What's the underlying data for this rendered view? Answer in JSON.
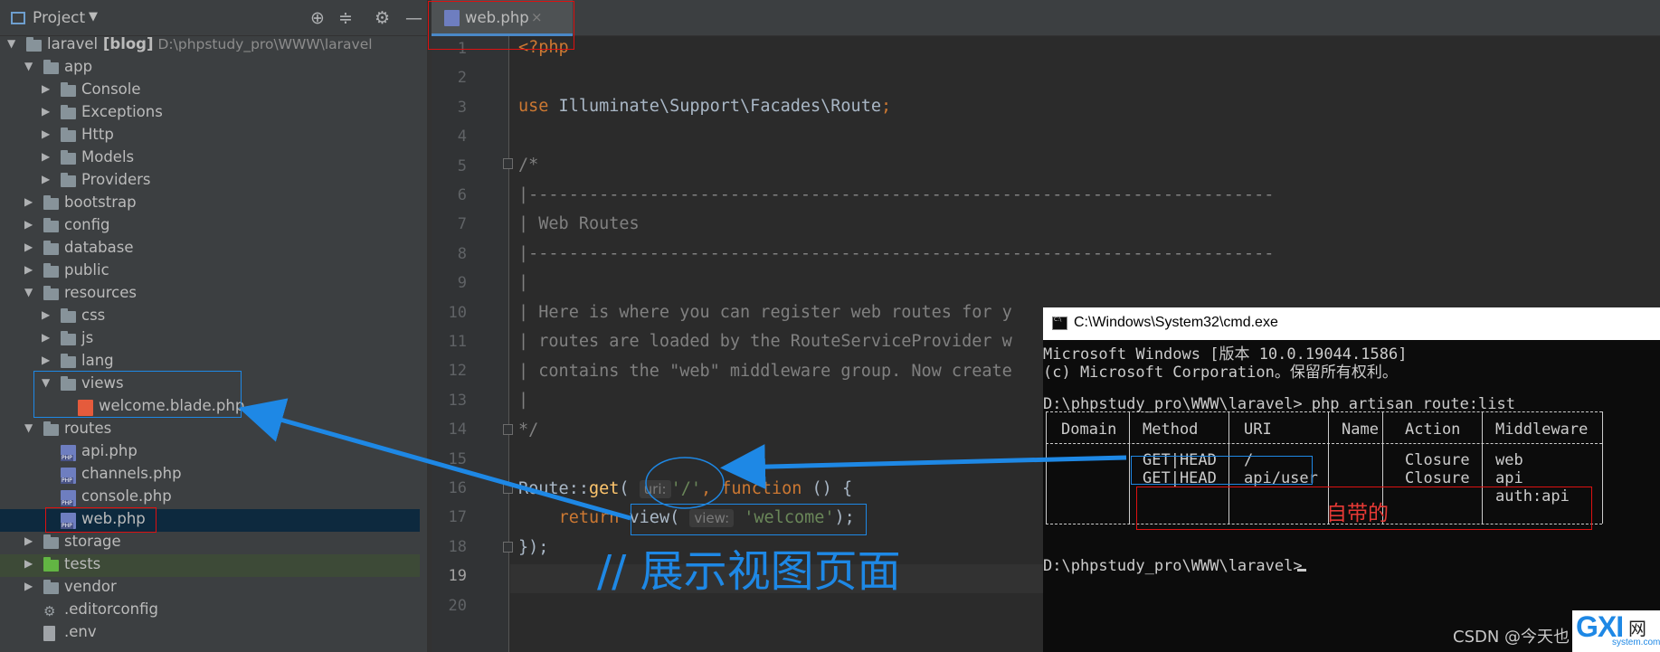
{
  "sidebar": {
    "title": "Project",
    "dropdown_glyph": "▼",
    "icons": [
      "target-icon",
      "collapse-icon",
      "gear-icon",
      "minimize-icon"
    ],
    "tree": [
      {
        "name": "tree-laravel",
        "label": "laravel",
        "extra": " [blog]",
        "path": "D:\\phpstudy_pro\\WWW\\laravel",
        "type": "folder",
        "open": true,
        "depth": 0
      },
      {
        "name": "tree-app",
        "label": "app",
        "type": "folder",
        "open": true,
        "depth": 1
      },
      {
        "name": "tree-console",
        "label": "Console",
        "type": "folder",
        "open": false,
        "depth": 2
      },
      {
        "name": "tree-exceptions",
        "label": "Exceptions",
        "type": "folder",
        "open": false,
        "depth": 2
      },
      {
        "name": "tree-http",
        "label": "Http",
        "type": "folder",
        "open": false,
        "depth": 2
      },
      {
        "name": "tree-models",
        "label": "Models",
        "type": "folder",
        "open": false,
        "depth": 2
      },
      {
        "name": "tree-providers",
        "label": "Providers",
        "type": "folder",
        "open": false,
        "depth": 2
      },
      {
        "name": "tree-bootstrap",
        "label": "bootstrap",
        "type": "folder",
        "open": false,
        "depth": 1
      },
      {
        "name": "tree-config",
        "label": "config",
        "type": "folder",
        "open": false,
        "depth": 1
      },
      {
        "name": "tree-database",
        "label": "database",
        "type": "folder",
        "open": false,
        "depth": 1
      },
      {
        "name": "tree-public",
        "label": "public",
        "type": "folder",
        "open": false,
        "depth": 1
      },
      {
        "name": "tree-resources",
        "label": "resources",
        "type": "folder",
        "open": true,
        "depth": 1
      },
      {
        "name": "tree-css",
        "label": "css",
        "type": "folder",
        "open": false,
        "depth": 2
      },
      {
        "name": "tree-js",
        "label": "js",
        "type": "folder",
        "open": false,
        "depth": 2
      },
      {
        "name": "tree-lang",
        "label": "lang",
        "type": "folder",
        "open": false,
        "depth": 2
      },
      {
        "name": "tree-views",
        "label": "views",
        "type": "folder",
        "open": true,
        "depth": 2
      },
      {
        "name": "tree-welcome-blade",
        "label": "welcome.blade.php",
        "type": "blade",
        "depth": 3
      },
      {
        "name": "tree-routes",
        "label": "routes",
        "type": "folder",
        "open": true,
        "depth": 1
      },
      {
        "name": "tree-api-php",
        "label": "api.php",
        "type": "php",
        "depth": 2
      },
      {
        "name": "tree-channels-php",
        "label": "channels.php",
        "type": "php",
        "depth": 2
      },
      {
        "name": "tree-console-php",
        "label": "console.php",
        "type": "php",
        "depth": 2
      },
      {
        "name": "tree-web-php",
        "label": "web.php",
        "type": "php",
        "depth": 2,
        "selected": true
      },
      {
        "name": "tree-storage",
        "label": "storage",
        "type": "folder",
        "open": false,
        "depth": 1
      },
      {
        "name": "tree-tests",
        "label": "tests",
        "type": "folder-green",
        "open": false,
        "depth": 1
      },
      {
        "name": "tree-vendor",
        "label": "vendor",
        "type": "folder",
        "open": false,
        "depth": 1
      },
      {
        "name": "tree-editorconfig",
        "label": ".editorconfig",
        "type": "gear",
        "depth": 1
      },
      {
        "name": "tree-env",
        "label": ".env",
        "type": "doc",
        "depth": 1
      }
    ]
  },
  "editor": {
    "tab": {
      "label": "web.php",
      "close": "×"
    },
    "line_numbers": [
      "1",
      "2",
      "3",
      "4",
      "5",
      "6",
      "7",
      "8",
      "9",
      "10",
      "11",
      "12",
      "13",
      "14",
      "15",
      "16",
      "17",
      "18",
      "19",
      "20"
    ],
    "lines": {
      "l1": "<?php",
      "l3_kw": "use",
      "l3_rest": " Illuminate\\Support\\Facades\\Route",
      "l3_semi": ";",
      "l5": "/*",
      "l6": "|--------------------------------------------------------------------------",
      "l7": "| Web Routes",
      "l8": "|--------------------------------------------------------------------------",
      "l9": "|",
      "l10": "| Here is where you can register web routes for y",
      "l11": "| routes are loaded by the RouteServiceProvider w",
      "l12": "| contains the \"web\" middleware group. Now create",
      "l13": "|",
      "l14": "*/",
      "l16_a": "Route::",
      "l16_fn": "get",
      "l16_b": "( ",
      "l16_hint": "uri:",
      "l16_str": "'/'",
      "l16_c": ", ",
      "l16_kw": "function",
      "l16_d": " () {",
      "l17_kw": "return",
      "l17_a": " view( ",
      "l17_hint": "view:",
      "l17_str": "'welcome'",
      "l17_b": ");",
      "l18": "});"
    }
  },
  "cmd": {
    "title": "C:\\Windows\\System32\\cmd.exe",
    "line1": "Microsoft Windows [版本 10.0.19044.1586]",
    "line2": "(c) Microsoft Corporation。保留所有权利。",
    "prompt1": "D:\\phpstudy_pro\\WWW\\laravel> php artisan route:list",
    "headers": [
      "Domain",
      "Method",
      "URI",
      "Name",
      "Action",
      "Middleware"
    ],
    "rows": [
      {
        "domain": "",
        "method": "GET|HEAD",
        "uri": "/",
        "name": "",
        "action": "Closure",
        "middleware": "web"
      },
      {
        "domain": "",
        "method": "GET|HEAD",
        "uri": "api/user",
        "name": "",
        "action": "Closure",
        "middleware": "api",
        "middleware2": "auth:api"
      }
    ],
    "prompt2": "D:\\phpstudy_pro\\WWW\\laravel>"
  },
  "annotations": {
    "comment": "// 展示视图页面",
    "builtin": "自带的"
  },
  "watermark": {
    "text": "CSDN @今天也",
    "logo": "GXI",
    "logo_cn": "网",
    "domain": "system.com"
  },
  "colors": {
    "keyword": "#cc7832",
    "string": "#6a8759",
    "comment": "#808080",
    "function": "#ffc66d",
    "annotation_blue": "#1e88e5",
    "annotation_red": "#d11111",
    "cmd_header_green": "#13a10e"
  }
}
